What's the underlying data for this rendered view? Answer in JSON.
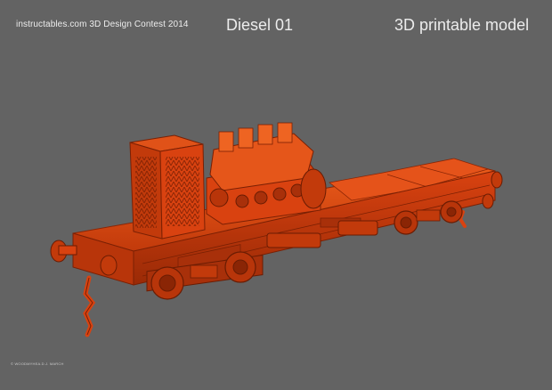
{
  "header": {
    "contest": "instructables.com 3D Design Contest 2014",
    "title": "Diesel 01",
    "subtitle": "3D printable model"
  },
  "footer": {
    "credit": "© WOODMYHEA.D.J. MARCH"
  },
  "colors": {
    "background": "#636363",
    "model_primary": "#d94210",
    "model_highlight": "#f0651f",
    "model_shadow": "#8a2505",
    "text": "#ececec"
  },
  "model": {
    "name": "diesel-railcar",
    "render_style": "orange translucent wireframe"
  }
}
